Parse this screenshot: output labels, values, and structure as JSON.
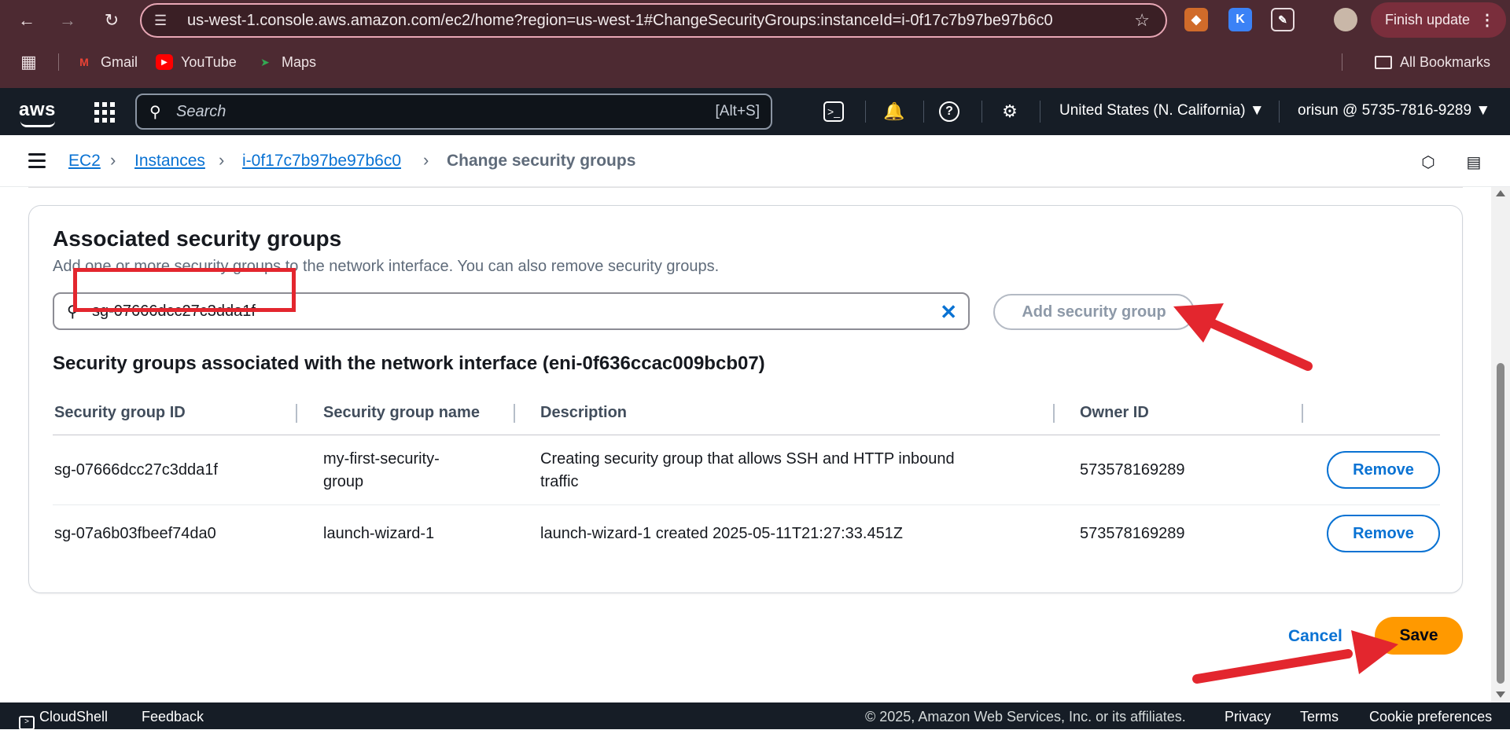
{
  "browser": {
    "url": "us-west-1.console.aws.amazon.com/ec2/home?region=us-west-1#ChangeSecurityGroups:instanceId=i-0f17c7b97be97b6c0",
    "finish_update": "Finish update",
    "bookmarks": [
      {
        "label": "Gmail",
        "icon": "gmail-icon"
      },
      {
        "label": "YouTube",
        "icon": "youtube-icon"
      },
      {
        "label": "Maps",
        "icon": "maps-icon"
      }
    ],
    "all_bookmarks": "All Bookmarks"
  },
  "aws_nav": {
    "logo": "aws",
    "search_placeholder": "Search",
    "search_shortcut": "[Alt+S]",
    "region": "United States (N. California) ▼",
    "account": "orisun @ 5735-7816-9289 ▼"
  },
  "breadcrumb": {
    "items": [
      "EC2",
      "Instances",
      "i-0f17c7b97be97b6c0"
    ],
    "current": "Change security groups"
  },
  "panel": {
    "title": "Associated security groups",
    "description": "Add one or more security groups to the network interface. You can also remove security groups.",
    "search_value": "sg-07666dcc27c3dda1f",
    "add_button": "Add security group",
    "table_title": "Security groups associated with the network interface (eni-0f636ccac009bcb07)",
    "columns": [
      "Security group ID",
      "Security group name",
      "Description",
      "Owner ID"
    ],
    "rows": [
      {
        "id": "sg-07666dcc27c3dda1f",
        "name_line1": "my-first-security-",
        "name_line2": "group",
        "desc_line1": "Creating security group that allows SSH and HTTP inbound",
        "desc_line2": "traffic",
        "owner": "573578169289",
        "action": "Remove"
      },
      {
        "id": "sg-07a6b03fbeef74da0",
        "name_line1": "launch-wizard-1",
        "name_line2": "",
        "desc_line1": "launch-wizard-1 created 2025-05-11T21:27:33.451Z",
        "desc_line2": "",
        "owner": "573578169289",
        "action": "Remove"
      }
    ]
  },
  "actions": {
    "cancel": "Cancel",
    "save": "Save"
  },
  "footer": {
    "cloudshell": "CloudShell",
    "feedback": "Feedback",
    "copyright": "© 2025, Amazon Web Services, Inc. or its affiliates.",
    "privacy": "Privacy",
    "terms": "Terms",
    "cookies": "Cookie preferences"
  },
  "colors": {
    "accent": "#0972d3",
    "save": "#ff9900",
    "annotation": "#e3262e"
  }
}
